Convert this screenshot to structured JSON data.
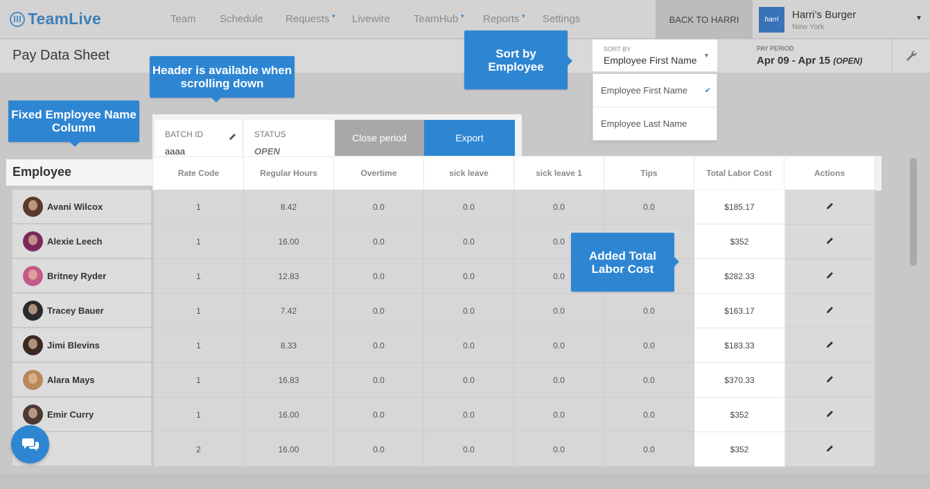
{
  "app": {
    "name": "TeamLive"
  },
  "nav": {
    "items": [
      {
        "label": "Team",
        "dropdown": false
      },
      {
        "label": "Schedule",
        "dropdown": false
      },
      {
        "label": "Requests",
        "dropdown": true
      },
      {
        "label": "Livewire",
        "dropdown": false
      },
      {
        "label": "TeamHub",
        "dropdown": true
      },
      {
        "label": "Reports",
        "dropdown": true
      },
      {
        "label": "Settings",
        "dropdown": false
      }
    ],
    "back_label": "BACK TO HARRI",
    "store": {
      "logo_text": "harri",
      "name": "Harri’s Burger",
      "city": "New York"
    }
  },
  "page": {
    "title": "Pay Data Sheet"
  },
  "sort": {
    "label": "SORT BY",
    "value": "Employee First Name",
    "options": [
      {
        "label": "Employee First Name",
        "selected": true
      },
      {
        "label": "Employee Last Name",
        "selected": false
      }
    ]
  },
  "pay_period": {
    "label": "PAY PERIOD",
    "range": "Apr 09 - Apr 15",
    "state": "(OPEN)"
  },
  "batch": {
    "batch_label": "BATCH ID",
    "batch_value": "aaaa",
    "status_label": "STATUS",
    "status_value": "OPEN",
    "close_label": "Close period",
    "export_label": "Export"
  },
  "table": {
    "employee_header": "Employee",
    "columns": [
      "Rate Code",
      "Regular Hours",
      "Overtime",
      "sick leave",
      "sick leave 1",
      "Tips",
      "Total Labor Cost",
      "Actions"
    ],
    "rows": [
      {
        "name": "Avani Wilcox",
        "cells": [
          "1",
          "8.42",
          "0.0",
          "0.0",
          "0.0",
          "0.0",
          "$185.17"
        ]
      },
      {
        "name": "Alexie Leech",
        "cells": [
          "1",
          "16.00",
          "0.0",
          "0.0",
          "0.0",
          "",
          "$352"
        ]
      },
      {
        "name": "Britney Ryder",
        "cells": [
          "1",
          "12.83",
          "0.0",
          "0.0",
          "0.0",
          "",
          "$282.33"
        ]
      },
      {
        "name": "Tracey Bauer",
        "cells": [
          "1",
          "7.42",
          "0.0",
          "0.0",
          "0.0",
          "0.0",
          "$163.17"
        ]
      },
      {
        "name": "Jimi Blevins",
        "cells": [
          "1",
          "8.33",
          "0.0",
          "0.0",
          "0.0",
          "0.0",
          "$183.33"
        ]
      },
      {
        "name": "Alara Mays",
        "cells": [
          "1",
          "16.83",
          "0.0",
          "0.0",
          "0.0",
          "0.0",
          "$370.33"
        ]
      },
      {
        "name": "Emir Curry",
        "cells": [
          "1",
          "16.00",
          "0.0",
          "0.0",
          "0.0",
          "0.0",
          "$352"
        ]
      },
      {
        "name": "",
        "cells": [
          "2",
          "16.00",
          "0.0",
          "0.0",
          "0.0",
          "0.0",
          "$352"
        ]
      }
    ]
  },
  "callouts": {
    "header": "Header is available when scrolling down",
    "fixed": "Fixed Employee Name Column",
    "sort": "Sort by Employee",
    "total": "Added Total Labor Cost"
  },
  "colors": {
    "accent": "#2e86d3",
    "brand": "#3e7fb9",
    "close_button": "#a8a8a8"
  }
}
